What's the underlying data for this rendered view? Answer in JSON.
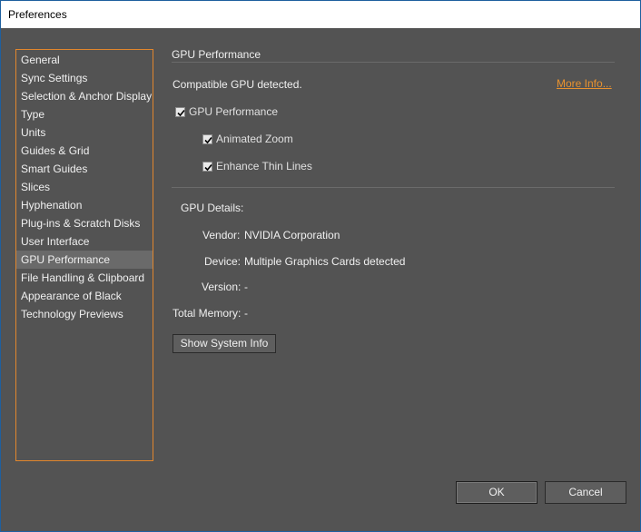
{
  "window": {
    "title": "Preferences"
  },
  "sidebar": {
    "items": [
      {
        "label": "General"
      },
      {
        "label": "Sync Settings"
      },
      {
        "label": "Selection & Anchor Display"
      },
      {
        "label": "Type"
      },
      {
        "label": "Units"
      },
      {
        "label": "Guides & Grid"
      },
      {
        "label": "Smart Guides"
      },
      {
        "label": "Slices"
      },
      {
        "label": "Hyphenation"
      },
      {
        "label": "Plug-ins & Scratch Disks"
      },
      {
        "label": "User Interface"
      },
      {
        "label": "GPU Performance",
        "selected": true
      },
      {
        "label": "File Handling & Clipboard"
      },
      {
        "label": "Appearance of Black"
      },
      {
        "label": "Technology Previews"
      }
    ]
  },
  "panel": {
    "title": "GPU Performance",
    "status": "Compatible GPU detected.",
    "more_info": "More Info...",
    "gpu_performance": {
      "label": "GPU Performance",
      "checked": true
    },
    "animated_zoom": {
      "label": "Animated Zoom",
      "checked": true
    },
    "enhance_thin_lines": {
      "label": "Enhance Thin Lines",
      "checked": true
    },
    "details_heading": "GPU Details:",
    "vendor_label": "Vendor:",
    "vendor_value": "NVIDIA Corporation",
    "device_label": "Device:",
    "device_value": "Multiple Graphics Cards detected",
    "version_label": "Version:",
    "version_value": "-",
    "memory_label": "Total Memory:",
    "memory_value": "-",
    "show_system_info": "Show System Info"
  },
  "footer": {
    "ok": "OK",
    "cancel": "Cancel"
  },
  "colors": {
    "accent": "#e8922f",
    "background": "#535353",
    "selected": "#6a6a6a"
  }
}
